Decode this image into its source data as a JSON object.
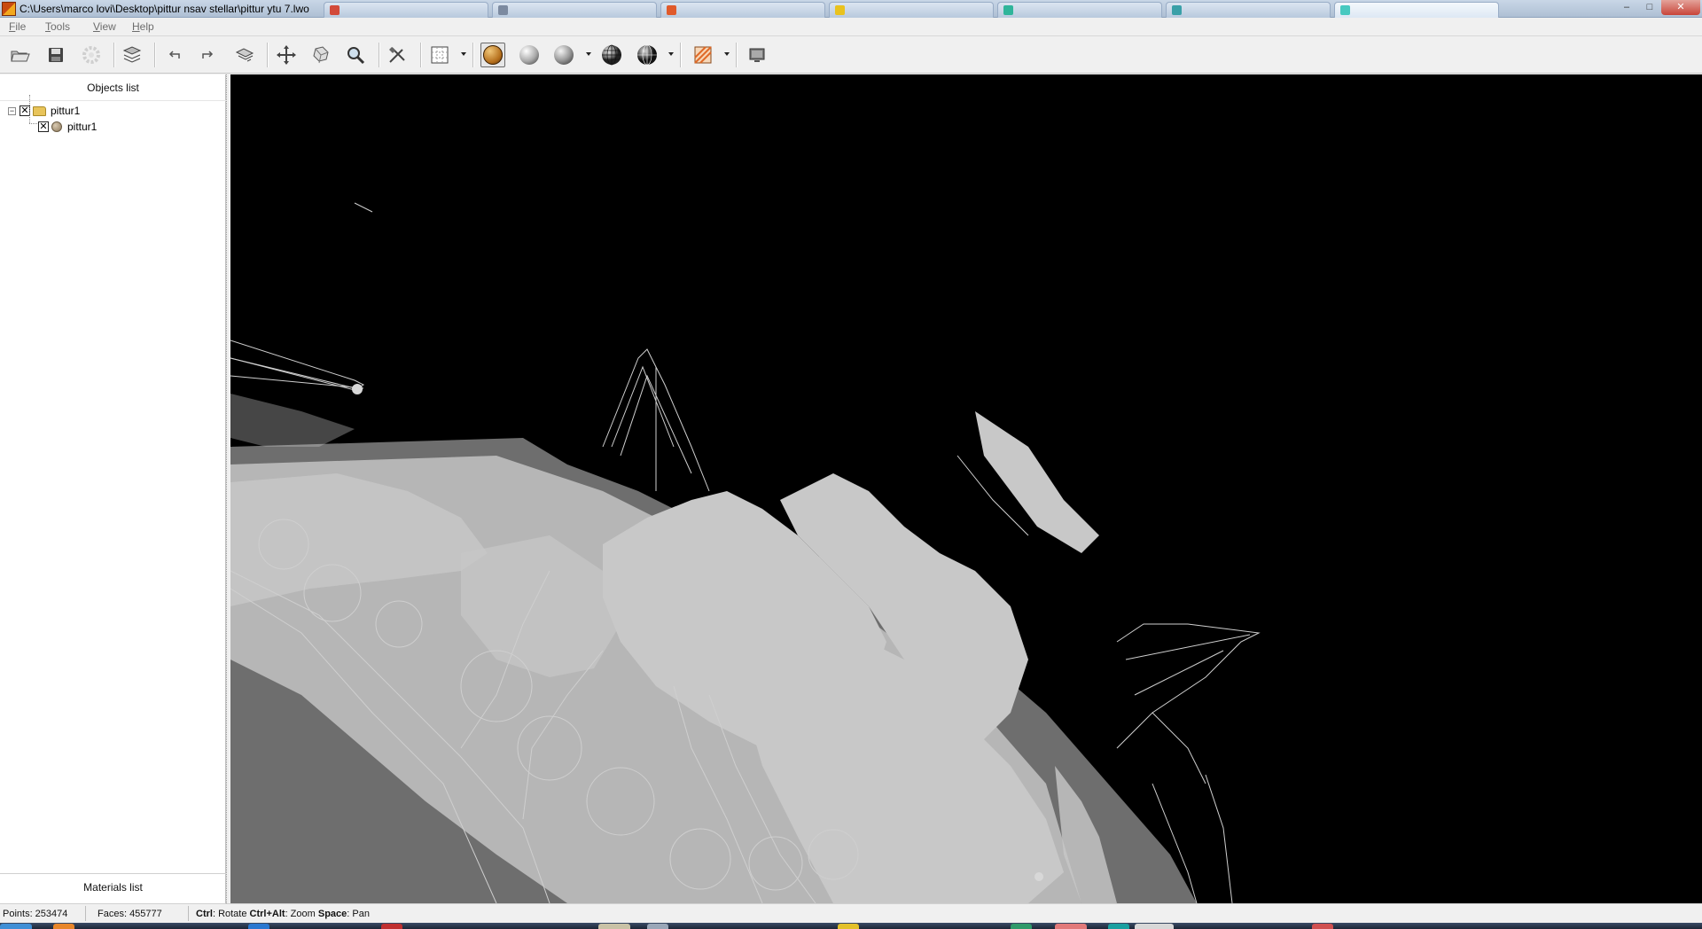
{
  "window": {
    "title": "C:\\Users\\marco lovi\\Desktop\\pittur nsav stellar\\pittur ytu 7.lwo",
    "icon": "app-icon",
    "controls": [
      "minimize-icon",
      "maximize-icon",
      "close-icon"
    ]
  },
  "menubar": {
    "items": [
      {
        "label": "File"
      },
      {
        "label": "Tools"
      },
      {
        "label": "View"
      },
      {
        "label": "Help"
      }
    ]
  },
  "toolbar": {
    "buttons": [
      {
        "name": "open-icon"
      },
      {
        "name": "save-icon"
      },
      {
        "name": "settings-gear-icon",
        "disabled": true
      },
      {
        "name": "layers-icon"
      },
      {
        "name": "undo-icon"
      },
      {
        "name": "redo-icon"
      },
      {
        "name": "reset-view-icon"
      },
      {
        "name": "move-icon"
      },
      {
        "name": "rotate-icon"
      },
      {
        "name": "zoom-icon"
      },
      {
        "name": "tools-icon"
      },
      {
        "name": "grid-display-icon"
      },
      {
        "name": "textured-shading-icon",
        "pressed": true
      },
      {
        "name": "smooth-shading-icon"
      },
      {
        "name": "flat-shading-icon"
      },
      {
        "name": "wireframe-shaded-icon"
      },
      {
        "name": "wireframe-icon"
      },
      {
        "name": "background-icon"
      },
      {
        "name": "screenshot-icon"
      }
    ]
  },
  "objects_panel": {
    "header": "Objects list",
    "tree": [
      {
        "label": "pittur1",
        "type": "folder",
        "checked": true,
        "expanded": true,
        "children": [
          {
            "label": "pittur1",
            "type": "object",
            "checked": true
          }
        ]
      }
    ]
  },
  "materials_panel": {
    "header": "Materials list"
  },
  "viewport": {
    "background": "#000000",
    "mesh_color": "#c8c8c8",
    "render_mode": "wireframe"
  },
  "statusbar": {
    "points": "Points: 253474",
    "faces": "Faces: 455777",
    "hint_ctrl_key": "Ctrl",
    "hint_ctrl_action": ": Rotate ",
    "hint_ctrlalt_key": "Ctrl+Alt",
    "hint_ctrlalt_action": ": Zoom ",
    "hint_space_key": "Space",
    "hint_space_action": ": Pan"
  },
  "colors": {
    "titlebar": "#bccbdd",
    "chrome": "#f0f0f0",
    "viewport": "#000000",
    "mesh": "#c8c8c8"
  }
}
